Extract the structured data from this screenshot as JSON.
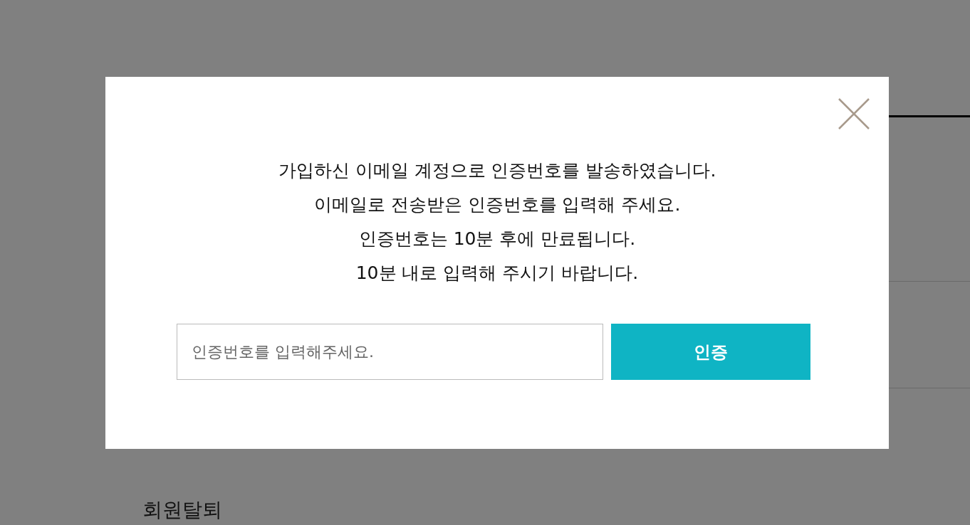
{
  "background": {
    "heading": "회원탈퇴"
  },
  "dialog": {
    "message_lines": [
      "가입하신 이메일 계정으로 인증번호를 발송하였습니다.",
      "이메일로 전송받은 인증번호를 입력해 주세요.",
      "인증번호는 10분 후에 만료됩니다.",
      "10분 내로 입력해 주시기 바랍니다."
    ],
    "code_field": {
      "placeholder": "인증번호를 입력해주세요."
    },
    "submit_button": "인증"
  }
}
